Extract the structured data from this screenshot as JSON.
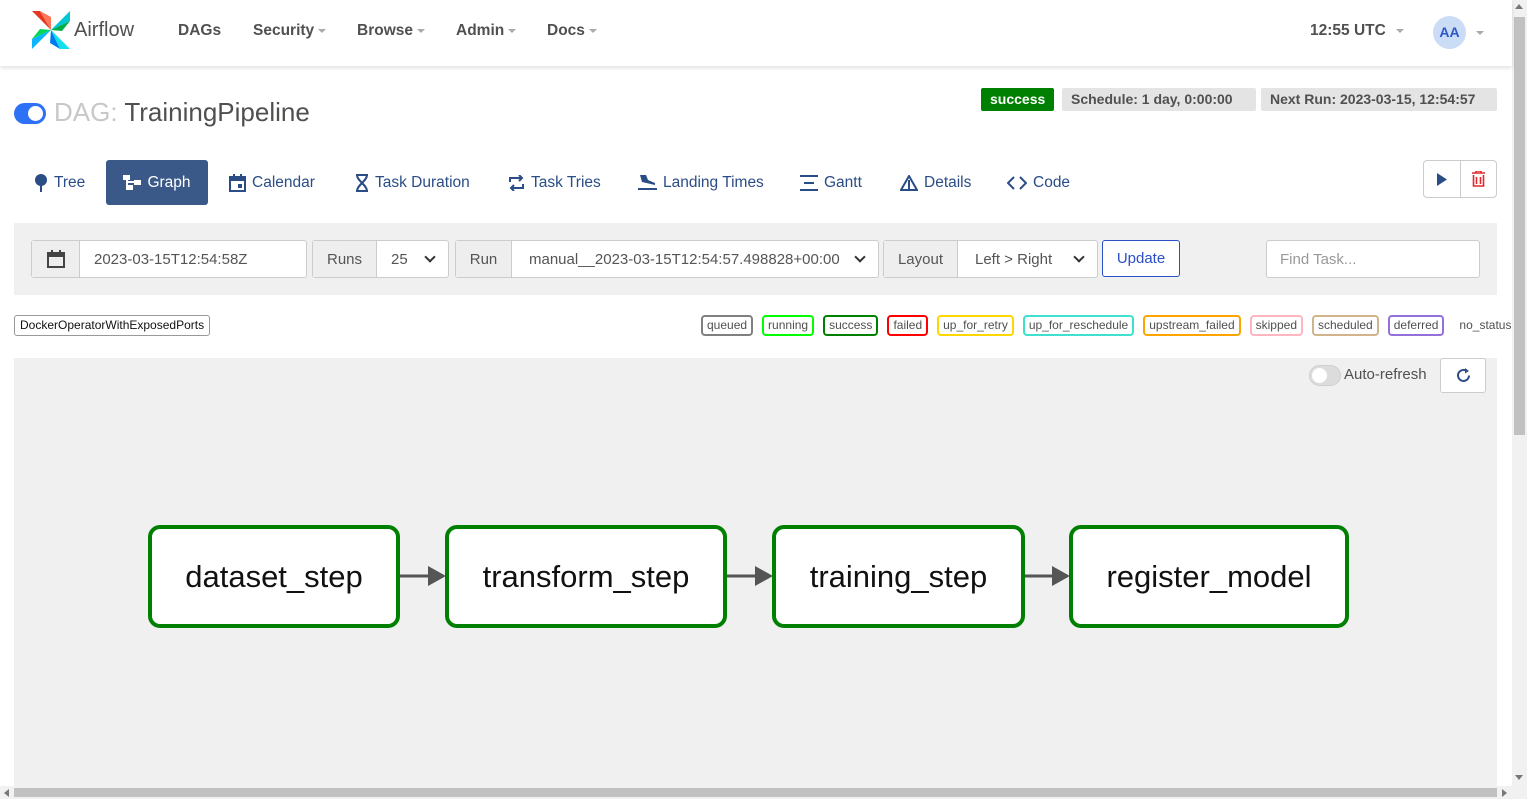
{
  "navbar": {
    "brand": "Airflow",
    "menu": [
      {
        "label": "DAGs",
        "dropdown": false
      },
      {
        "label": "Security",
        "dropdown": true
      },
      {
        "label": "Browse",
        "dropdown": true
      },
      {
        "label": "Admin",
        "dropdown": true
      },
      {
        "label": "Docs",
        "dropdown": true
      }
    ],
    "clock": "12:55 UTC",
    "user_initials": "AA"
  },
  "dag": {
    "prefix": "DAG:",
    "name": "TrainingPipeline",
    "paused": false,
    "status": "success",
    "schedule": "Schedule: 1 day, 0:00:00",
    "next_run": "Next Run: 2023-03-15, 12:54:57"
  },
  "tabs": [
    {
      "label": "Tree",
      "icon": "tree-icon",
      "active": false
    },
    {
      "label": "Graph",
      "icon": "graph-icon",
      "active": true
    },
    {
      "label": "Calendar",
      "icon": "calendar-icon",
      "active": false
    },
    {
      "label": "Task Duration",
      "icon": "hourglass-icon",
      "active": false
    },
    {
      "label": "Task Tries",
      "icon": "repeat-icon",
      "active": false
    },
    {
      "label": "Landing Times",
      "icon": "plane-landing-icon",
      "active": false
    },
    {
      "label": "Gantt",
      "icon": "gantt-icon",
      "active": false
    },
    {
      "label": "Details",
      "icon": "triangle-icon",
      "active": false
    },
    {
      "label": "Code",
      "icon": "code-icon",
      "active": false
    }
  ],
  "controls": {
    "execution_date": "2023-03-15T12:54:58Z",
    "runs_label": "Runs",
    "runs_value": "25",
    "run_label": "Run",
    "run_value": "manual__2023-03-15T12:54:57.498828+00:00",
    "layout_label": "Layout",
    "layout_value": "Left > Right",
    "update_label": "Update",
    "find_task_placeholder": "Find Task..."
  },
  "legend": {
    "operator": "DockerOperatorWithExposedPorts",
    "states": [
      {
        "label": "queued",
        "color": "#808080"
      },
      {
        "label": "running",
        "color": "#00ff00"
      },
      {
        "label": "success",
        "color": "#008000"
      },
      {
        "label": "failed",
        "color": "#ff0000"
      },
      {
        "label": "up_for_retry",
        "color": "#ffd700"
      },
      {
        "label": "up_for_reschedule",
        "color": "#40e0d0"
      },
      {
        "label": "upstream_failed",
        "color": "#ffa500"
      },
      {
        "label": "skipped",
        "color": "#ffb6c1"
      },
      {
        "label": "scheduled",
        "color": "#d2b48c"
      },
      {
        "label": "deferred",
        "color": "#9370db"
      },
      {
        "label": "no_status",
        "color": ""
      }
    ]
  },
  "graph": {
    "auto_refresh_label": "Auto-refresh",
    "auto_refresh_on": false,
    "tasks": [
      {
        "id": "dataset_step",
        "state": "success"
      },
      {
        "id": "transform_step",
        "state": "success"
      },
      {
        "id": "training_step",
        "state": "success"
      },
      {
        "id": "register_model",
        "state": "success"
      }
    ]
  },
  "colors": {
    "success": "#008000",
    "active_tab": "#3b5988",
    "link": "#2a4d86",
    "toggle_on": "#2d71f5"
  }
}
